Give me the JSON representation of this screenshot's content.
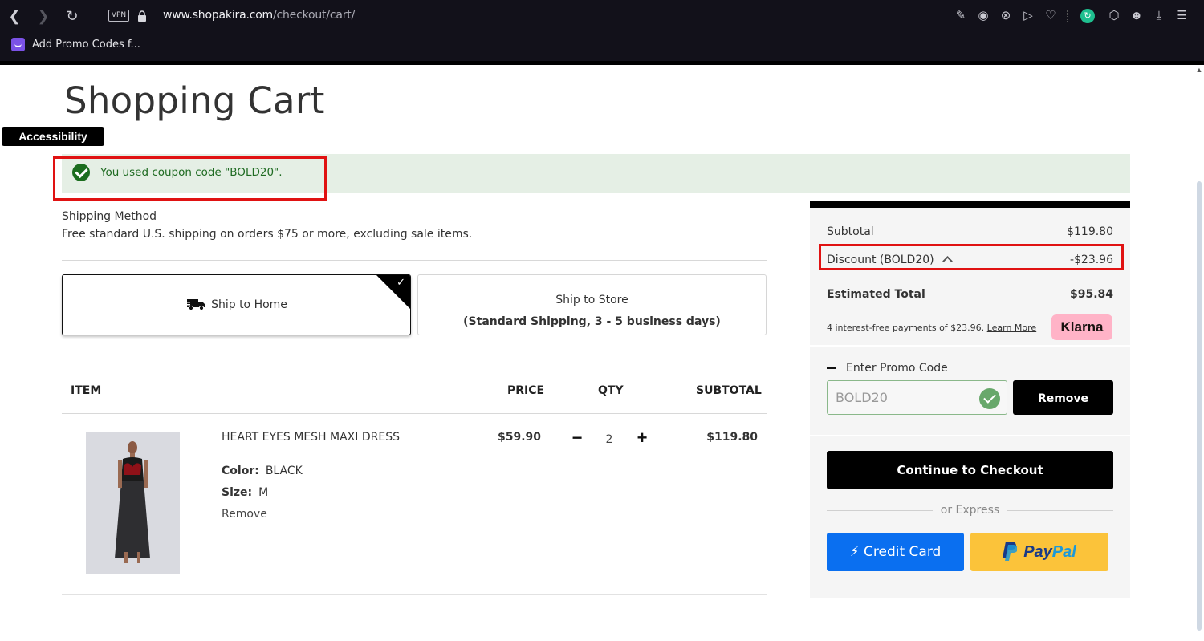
{
  "browser": {
    "url_host": "www.shopakira.com",
    "url_path": "/checkout/cart/",
    "vpn_label": "VPN",
    "bookmark_label": "Add Promo Codes f...",
    "nav_icons": [
      "back-icon",
      "forward-icon",
      "reload-icon"
    ],
    "toolbar_icons": [
      "edit-icon",
      "camera-icon",
      "shield-x-icon",
      "send-icon",
      "heart-icon",
      "sync-extension-icon",
      "cube-icon",
      "profile-icon",
      "download-icon",
      "settings-sliders-icon"
    ]
  },
  "page": {
    "title": "Shopping Cart",
    "accessibility_label": "Accessibility",
    "coupon_message": "You used coupon code \"BOLD20\".",
    "shipping": {
      "title": "Shipping Method",
      "description": "Free standard U.S. shipping on orders  $75 or more, excluding sale items.",
      "options": [
        {
          "label": "Ship to Home",
          "selected": true
        },
        {
          "label": "Ship to Store",
          "sublabel": "(Standard Shipping, 3 - 5 business days)",
          "selected": false
        }
      ]
    },
    "table": {
      "headers": {
        "item": "ITEM",
        "price": "PRICE",
        "qty": "QTY",
        "subtotal": "SUBTOTAL"
      },
      "items": [
        {
          "name": "HEART EYES MESH MAXI DRESS",
          "color_label": "Color:",
          "color": "BLACK",
          "size_label": "Size:",
          "size": "M",
          "remove_label": "Remove",
          "price": "$59.90",
          "qty": "2",
          "qty_minus": "−",
          "qty_plus": "+",
          "subtotal": "$119.80"
        }
      ]
    }
  },
  "summary": {
    "subtotal_label": "Subtotal",
    "subtotal": "$119.80",
    "discount_label": "Discount (BOLD20)",
    "discount": "-$23.96",
    "total_label": "Estimated Total",
    "total": "$95.84",
    "klarna_text": "4 interest-free payments of $23.96.",
    "klarna_link": "Learn More",
    "klarna_badge": "Klarna",
    "promo_toggle_label": "Enter Promo Code",
    "promo_value": "BOLD20",
    "promo_remove": "Remove",
    "checkout_label": "Continue to Checkout",
    "or_express": "or Express",
    "credit_card_label": "Credit Card",
    "paypal_pay": "Pay",
    "paypal_pal": "Pal"
  },
  "colors": {
    "success_bg": "#e5efe5",
    "success_text": "#1f6b22",
    "highlight_red": "#e01212",
    "credit_card_blue": "#0a6ff0",
    "paypal_yellow": "#fbc33a",
    "klarna_pink": "#ffb3c7"
  }
}
